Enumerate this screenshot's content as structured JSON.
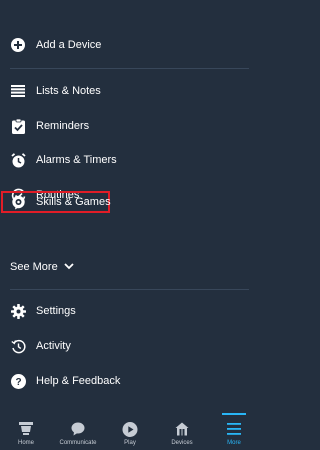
{
  "menu": {
    "add_device": "Add a Device",
    "lists_notes": "Lists & Notes",
    "reminders": "Reminders",
    "alarms_timers": "Alarms & Timers",
    "routines": "Routines",
    "skills_games": "Skills & Games",
    "see_more": "See More",
    "settings": "Settings",
    "activity": "Activity",
    "help_feedback": "Help & Feedback"
  },
  "tabbar": {
    "home": "Home",
    "communicate": "Communicate",
    "play": "Play",
    "devices": "Devices",
    "more": "More",
    "active": "More"
  },
  "colors": {
    "background": "#232f3e",
    "accent": "#29b6f6",
    "highlight": "#e11d27"
  }
}
